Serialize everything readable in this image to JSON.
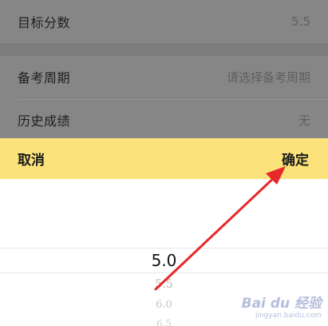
{
  "form": {
    "target_score": {
      "label": "目标分数",
      "value": "5.5"
    },
    "prep_period": {
      "label": "备考周期",
      "placeholder": "请选择备考周期"
    },
    "history_score": {
      "label": "历史成绩",
      "value": "无"
    }
  },
  "toolbar": {
    "cancel_label": "取消",
    "confirm_label": "确定",
    "background_color": "#fbe27a"
  },
  "picker": {
    "selected": "5.0",
    "options_below": [
      "5.5",
      "6.0",
      "6.5"
    ]
  },
  "annotation": {
    "arrow_color": "#e8282a",
    "points_to": "confirm-button"
  },
  "watermark": {
    "brand": "Bai du 经验",
    "sub": "jingyan.baidu.com"
  }
}
